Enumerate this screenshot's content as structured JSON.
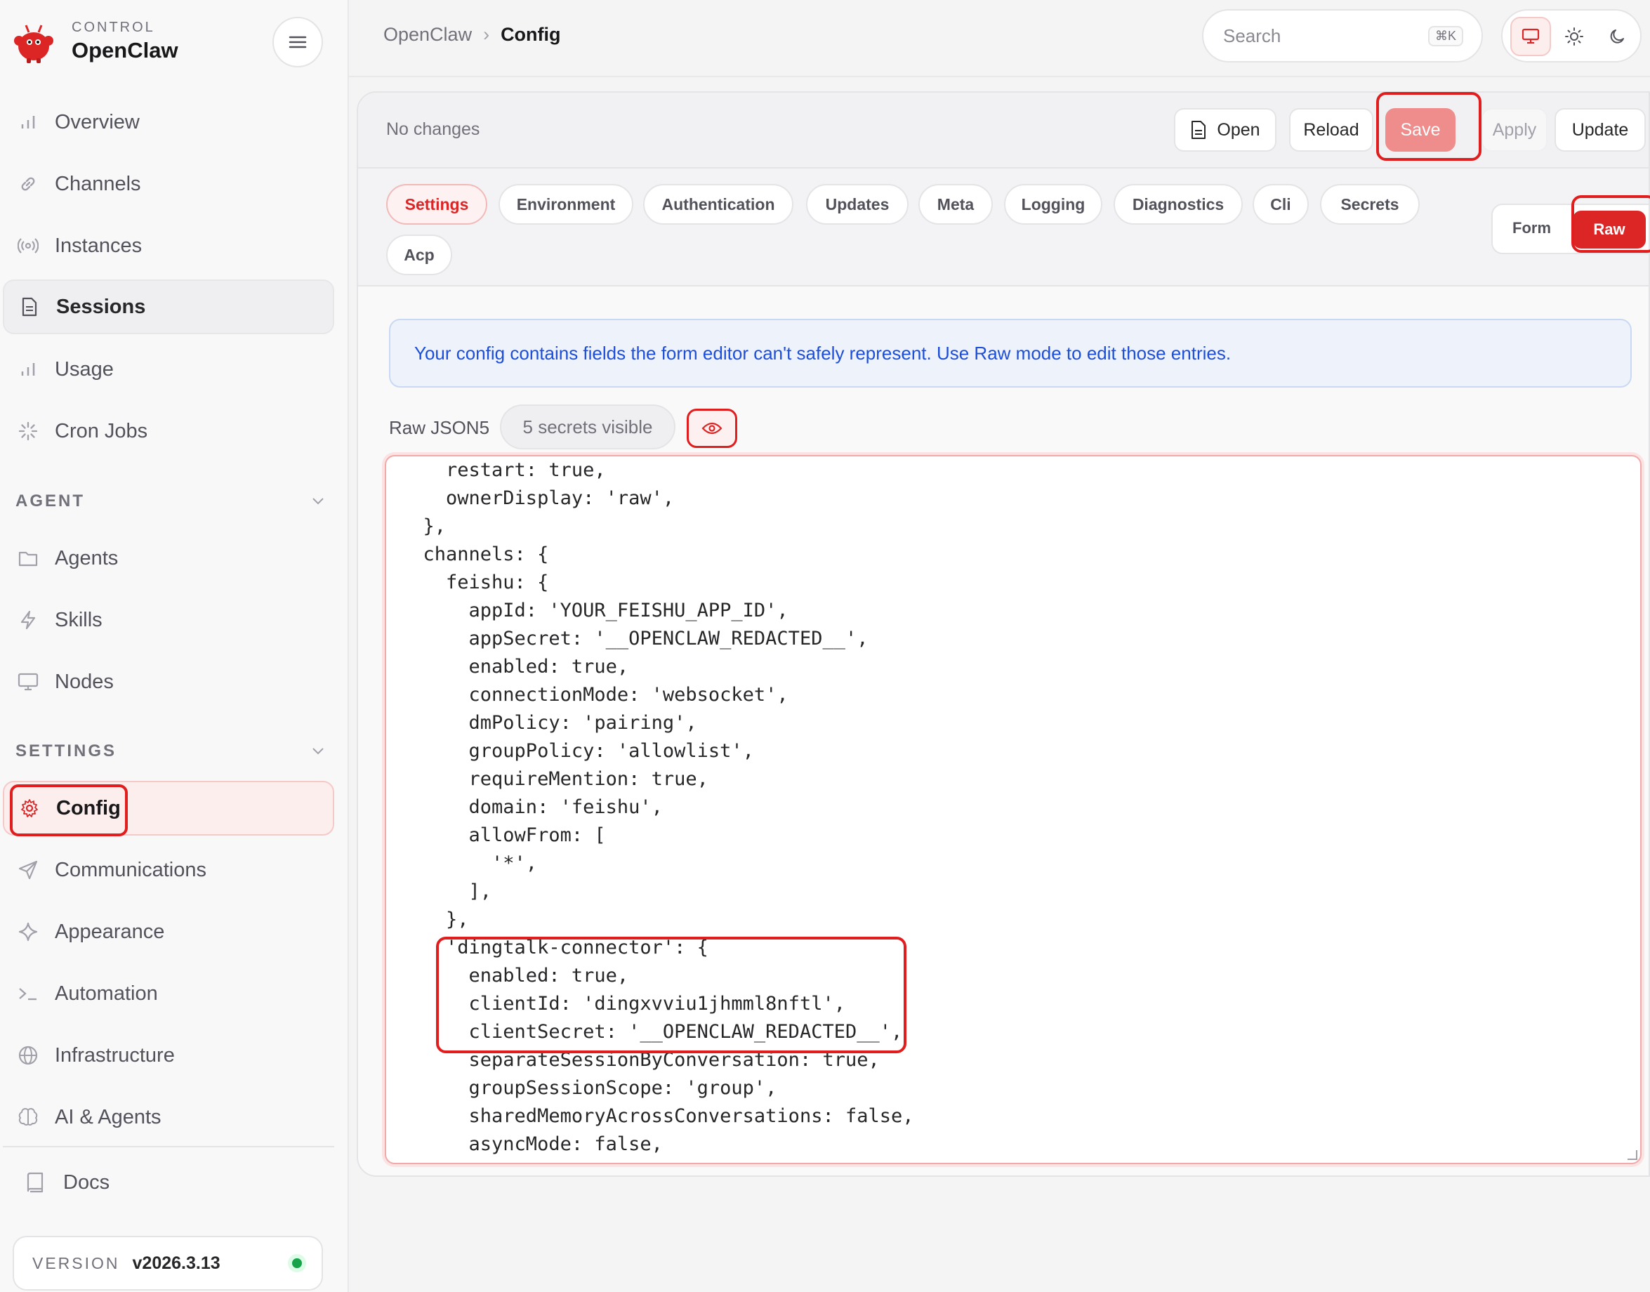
{
  "brand": {
    "subtitle": "CONTROL",
    "name": "OpenClaw"
  },
  "colors": {
    "accent": "#dc2626",
    "highlight_box": "#e11d1d",
    "notice_text": "#1d4ed8",
    "status_ok": "#16a34a"
  },
  "sidebar": {
    "items_top": [
      {
        "label": "Overview",
        "icon": "bar-chart-icon"
      },
      {
        "label": "Channels",
        "icon": "link-icon"
      },
      {
        "label": "Instances",
        "icon": "radio-icon"
      },
      {
        "label": "Sessions",
        "icon": "file-text-icon"
      },
      {
        "label": "Usage",
        "icon": "bar-chart-icon"
      },
      {
        "label": "Cron Jobs",
        "icon": "loader-icon"
      }
    ],
    "agent_section": "AGENT",
    "agent_items": [
      {
        "label": "Agents",
        "icon": "folder-icon"
      },
      {
        "label": "Skills",
        "icon": "zap-icon"
      },
      {
        "label": "Nodes",
        "icon": "monitor-icon"
      }
    ],
    "settings_section": "SETTINGS",
    "settings_items": [
      {
        "label": "Config",
        "icon": "gear-icon"
      },
      {
        "label": "Communications",
        "icon": "send-icon"
      },
      {
        "label": "Appearance",
        "icon": "sparkle-icon"
      },
      {
        "label": "Automation",
        "icon": "terminal-icon"
      },
      {
        "label": "Infrastructure",
        "icon": "globe-icon"
      },
      {
        "label": "AI & Agents",
        "icon": "brain-icon"
      }
    ],
    "docs": "Docs",
    "version_label": "VERSION",
    "version_value": "v2026.3.13"
  },
  "breadcrumb": {
    "root": "OpenClaw",
    "separator": "›",
    "current": "Config"
  },
  "search": {
    "placeholder": "Search",
    "shortcut": "⌘K"
  },
  "toolbar": {
    "status": "No changes",
    "open": "Open",
    "reload": "Reload",
    "save": "Save",
    "apply": "Apply",
    "update": "Update"
  },
  "tabs": [
    "Settings",
    "Environment",
    "Authentication",
    "Updates",
    "Meta",
    "Logging",
    "Diagnostics",
    "Cli",
    "Secrets",
    "Acp"
  ],
  "active_tab": "Settings",
  "mode": {
    "form": "Form",
    "raw": "Raw",
    "active": "Raw"
  },
  "notice": "Your config contains fields the form editor can't safely represent. Use Raw mode to edit those entries.",
  "raw": {
    "label": "Raw JSON5",
    "secrets_badge": "5 secrets visible"
  },
  "code_lines": [
    "    restart: true,",
    "    ownerDisplay: 'raw',",
    "  },",
    "  channels: {",
    "    feishu: {",
    "      appId: 'YOUR_FEISHU_APP_ID',",
    "      appSecret: '__OPENCLAW_REDACTED__',",
    "      enabled: true,",
    "      connectionMode: 'websocket',",
    "      dmPolicy: 'pairing',",
    "      groupPolicy: 'allowlist',",
    "      requireMention: true,",
    "      domain: 'feishu',",
    "      allowFrom: [",
    "        '*',",
    "      ],",
    "    },",
    "    'dingtalk-connector': {",
    "      enabled: true,",
    "      clientId: 'dingxvviu1jhmml8nftl',",
    "      clientSecret: '__OPENCLAW_REDACTED__',",
    "      separateSessionByConversation: true,",
    "      groupSessionScope: 'group',",
    "      sharedMemoryAcrossConversations: false,",
    "      asyncMode: false,"
  ]
}
